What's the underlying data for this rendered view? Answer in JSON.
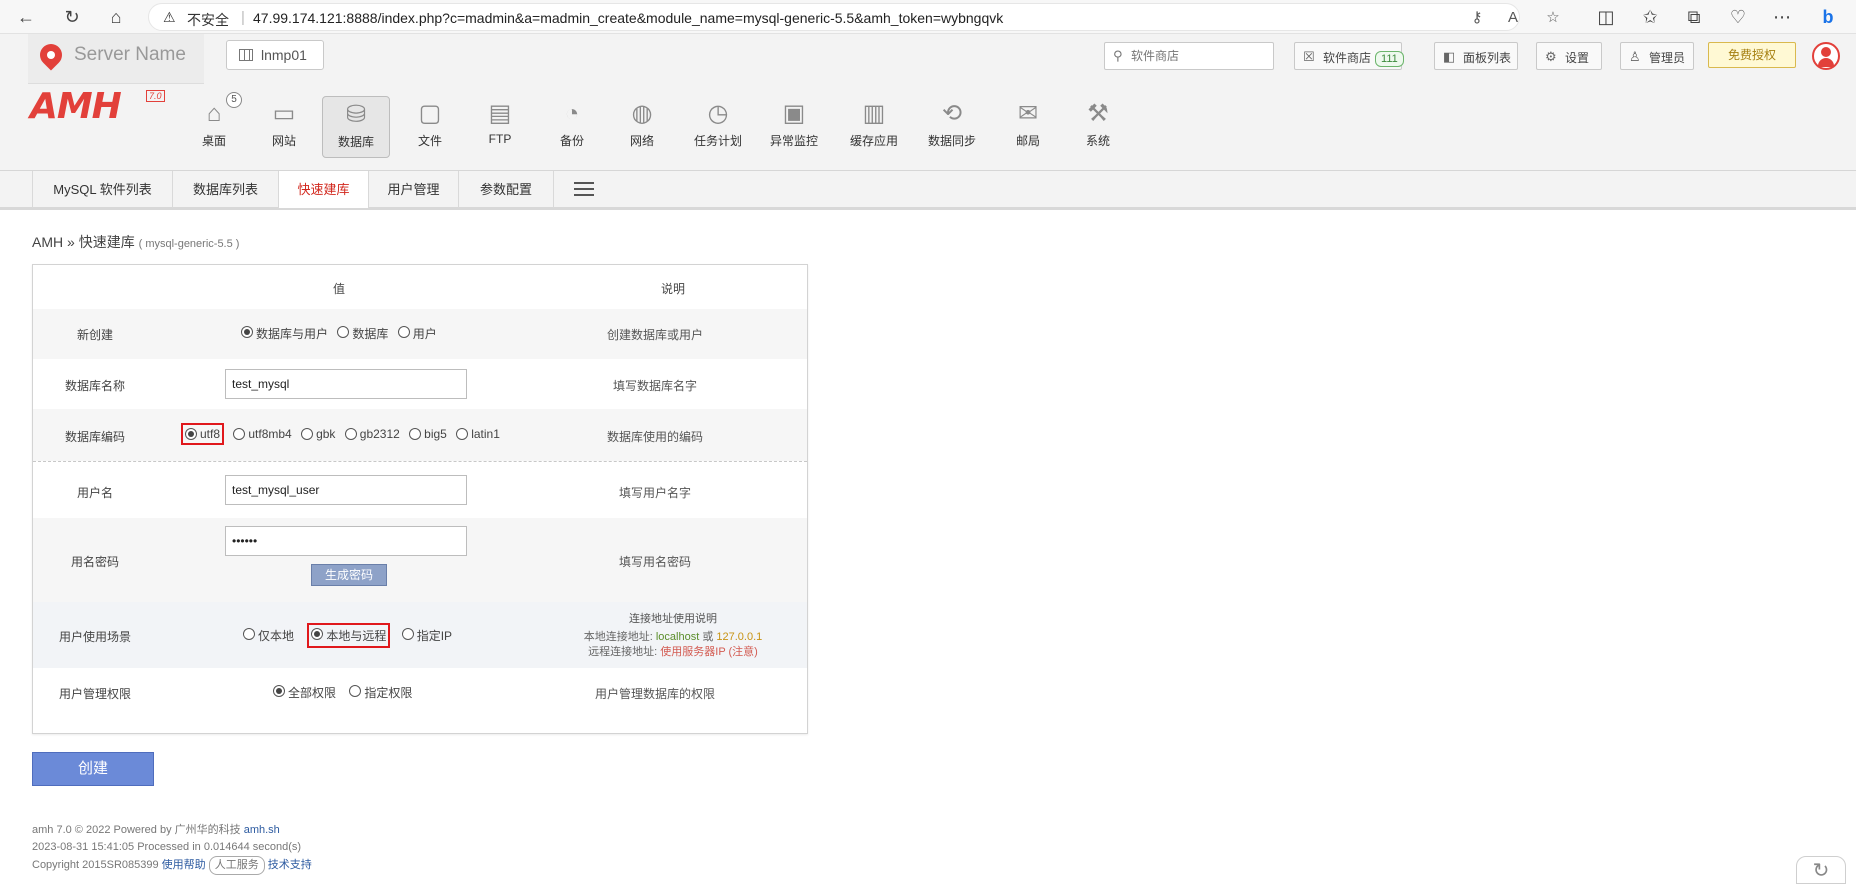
{
  "browser": {
    "insecure_label": "不安全",
    "url": "47.99.174.121:8888/index.php?c=madmin&a=madmin_create&module_name=mysql-generic-5.5&amh_token=wybngqvk"
  },
  "header": {
    "server_name": "Server Name",
    "env_label": "lnmp01",
    "search_placeholder": "软件商店",
    "store_label": "软件商店",
    "store_count": "111",
    "panel_list_label": "面板列表",
    "settings_label": "设置",
    "admin_label": "管理员",
    "free_license_label": "免费授权"
  },
  "logo": {
    "text": "AMH",
    "version": "7.0"
  },
  "nav": [
    {
      "label": "桌面",
      "icon": "home-icon",
      "badge": "5"
    },
    {
      "label": "网站",
      "icon": "monitor-icon"
    },
    {
      "label": "数据库",
      "icon": "database-icon"
    },
    {
      "label": "文件",
      "icon": "folder-icon"
    },
    {
      "label": "FTP",
      "icon": "ftp-icon"
    },
    {
      "label": "备份",
      "icon": "backup-icon"
    },
    {
      "label": "网络",
      "icon": "globe-icon"
    },
    {
      "label": "任务计划",
      "icon": "clock-icon"
    },
    {
      "label": "异常监控",
      "icon": "monitor-alert-icon"
    },
    {
      "label": "缓存应用",
      "icon": "cache-icon"
    },
    {
      "label": "数据同步",
      "icon": "sync-icon"
    },
    {
      "label": "邮局",
      "icon": "mail-icon"
    },
    {
      "label": "系统",
      "icon": "tools-icon"
    }
  ],
  "subnav": [
    "MySQL 软件列表",
    "数据库列表",
    "快速建库",
    "用户管理",
    "参数配置"
  ],
  "breadcrumb": {
    "root": "AMH",
    "sep": "»",
    "current": "快速建库",
    "module": "( mysql-generic-5.5 )"
  },
  "table": {
    "col_value": "值",
    "col_desc": "说明",
    "rows": {
      "create": {
        "label": "新创建",
        "options": [
          "数据库与用户",
          "数据库",
          "用户"
        ],
        "desc": "创建数据库或用户"
      },
      "db_name": {
        "label": "数据库名称",
        "value": "test_mysql",
        "desc": "填写数据库名字"
      },
      "encoding": {
        "label": "数据库编码",
        "options": [
          "utf8",
          "utf8mb4",
          "gbk",
          "gb2312",
          "big5",
          "latin1"
        ],
        "desc": "数据库使用的编码"
      },
      "username": {
        "label": "用户名",
        "value": "test_mysql_user",
        "desc": "填写用户名字"
      },
      "password": {
        "label": "用名密码",
        "value": "••••••",
        "gen_label": "生成密码",
        "desc": "填写用名密码"
      },
      "scene": {
        "label": "用户使用场景",
        "options": [
          "仅本地",
          "本地与远程",
          "指定IP"
        ],
        "desc_title": "连接地址使用说明",
        "local_prefix": "本地连接地址:",
        "local_host": "localhost",
        "or": "或",
        "local_ip": "127.0.0.1",
        "remote_prefix": "远程连接地址:",
        "remote_value": "使用服务器IP (注意)"
      },
      "perm": {
        "label": "用户管理权限",
        "options": [
          "全部权限",
          "指定权限"
        ],
        "desc": "用户管理数据库的权限"
      }
    }
  },
  "create_button": "创建",
  "footer": {
    "line1_text": "amh 7.0 © 2022 Powered by 广州华的科技",
    "line1_link": "amh.sh",
    "line2": "2023-08-31 15:41:05 Processed in 0.014644 second(s)",
    "line3_text": "Copyright 2015SR085399",
    "help_link": "使用帮助",
    "service_label": "人工服务",
    "support_link": "技术支持"
  }
}
